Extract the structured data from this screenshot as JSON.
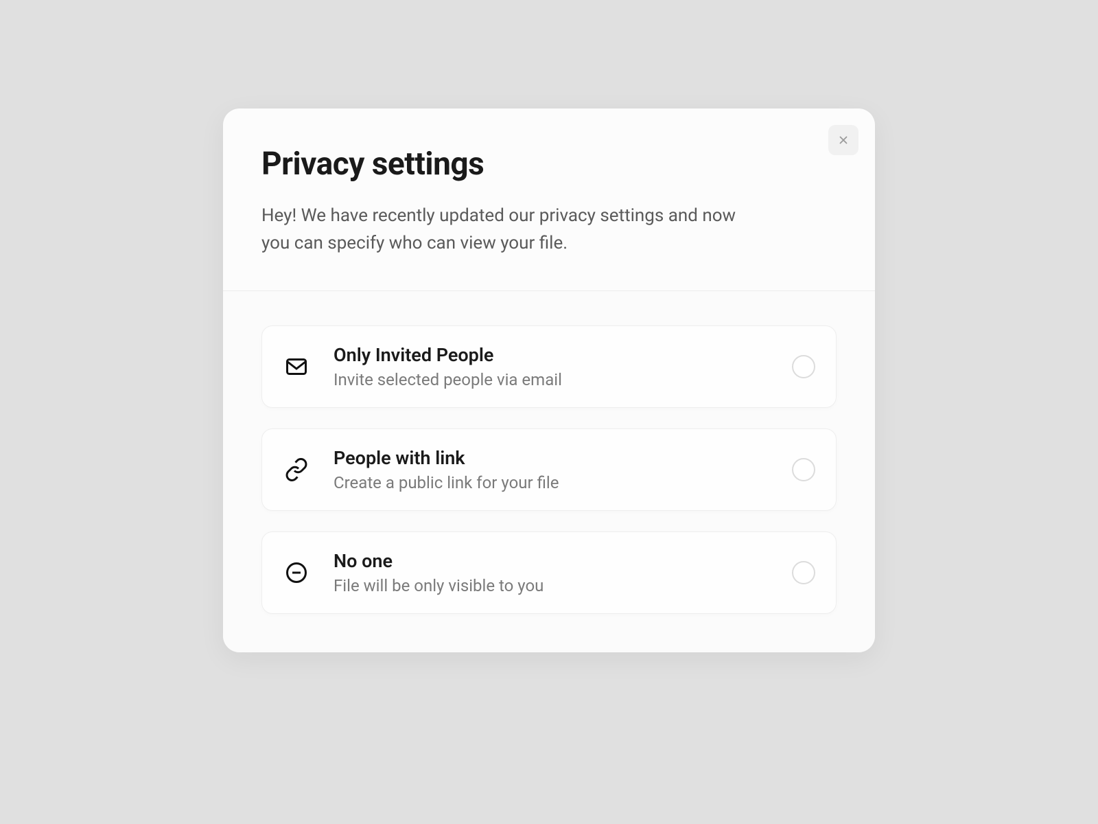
{
  "modal": {
    "title": "Privacy settings",
    "subtitle": "Hey! We have recently updated our privacy settings and now you can specify who can view your file."
  },
  "options": [
    {
      "title": "Only Invited People",
      "desc": "Invite selected people via email"
    },
    {
      "title": "People with link",
      "desc": "Create a public link for your file"
    },
    {
      "title": "No one",
      "desc": "File will be only visible to you"
    }
  ]
}
